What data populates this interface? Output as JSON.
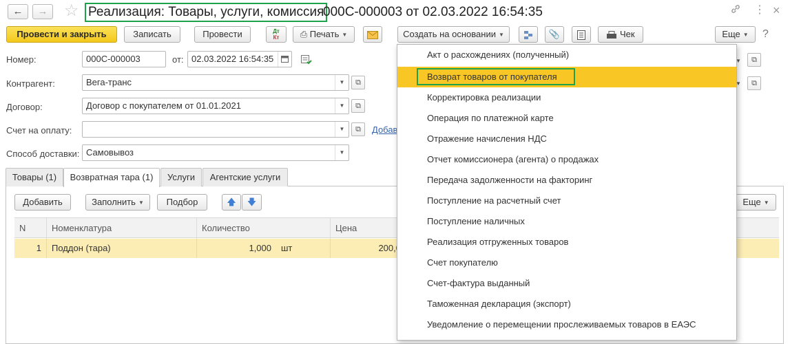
{
  "window": {
    "title_main": "Реализация: Товары, услуги, комиссия",
    "title_rest": "000С-000003 от 02.03.2022 16:54:35",
    "back_icon": "arrow-left-icon",
    "forward_icon": "arrow-right-icon",
    "favorite_icon": "star-icon",
    "link_icon": "link-icon",
    "more_icon": "vertical-dots-icon",
    "close_icon": "close-icon"
  },
  "toolbar": {
    "post_close": "Провести и закрыть",
    "save": "Записать",
    "post": "Провести",
    "dtkt_top": "Дт",
    "dtkt_bottom": "Кт",
    "print": "Печать",
    "create_based": "Создать на основании",
    "check": "Чек",
    "more": "Еще"
  },
  "form": {
    "number_label": "Номер:",
    "number_value": "000С-000003",
    "date_label": "от:",
    "date_value": "02.03.2022 16:54:35",
    "counterparty_label": "Контрагент:",
    "counterparty_value": "Вега-транс",
    "contract_label": "Договор:",
    "contract_value": "Договор с покупателем от 01.01.2021",
    "invoice_label": "Счет на оплату:",
    "invoice_value": "",
    "invoice_link": "Добав",
    "delivery_label": "Способ доставки:",
    "delivery_value": "Самовывоз"
  },
  "tabs": [
    {
      "label": "Товары (1)"
    },
    {
      "label": "Возвратная тара (1)"
    },
    {
      "label": "Услуги"
    },
    {
      "label": "Агентские услуги"
    }
  ],
  "table_toolbar": {
    "add": "Добавить",
    "fill": "Заполнить",
    "select": "Подбор",
    "more": "Еще"
  },
  "table": {
    "columns": [
      "N",
      "Номенклатура",
      "Количество",
      "Цена"
    ],
    "rows": [
      {
        "n": "1",
        "item": "Поддон (тара)",
        "qty": "1,000",
        "unit": "шт",
        "price": "200,0"
      }
    ]
  },
  "menu": {
    "items": [
      "Акт о расхождениях (полученный)",
      "Возврат товаров от покупателя",
      "Корректировка реализации",
      "Операция по платежной карте",
      "Отражение начисления НДС",
      "Отчет комиссионера (агента) о продажах",
      "Передача задолженности на факторинг",
      "Поступление на расчетный счет",
      "Поступление наличных",
      "Реализация отгруженных товаров",
      "Счет покупателю",
      "Счет-фактура выданный",
      "Таможенная декларация (экспорт)",
      "Уведомление о перемещении прослеживаемых товаров в ЕАЭС"
    ],
    "selected_index": 1
  },
  "colors": {
    "primary_button": "#f3c81b",
    "highlight_box": "#1fa34a",
    "menu_selected": "#f8c725",
    "row_selected": "#fcedb5",
    "link": "#3562a8"
  }
}
